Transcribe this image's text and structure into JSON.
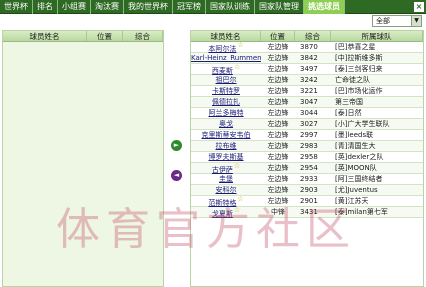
{
  "nav": {
    "items": [
      {
        "label": "世界杯",
        "active": false
      },
      {
        "label": "排名",
        "active": false
      },
      {
        "label": "小组赛",
        "active": false
      },
      {
        "label": "淘汰赛",
        "active": false
      },
      {
        "label": "我的世界杯",
        "active": false
      },
      {
        "label": "冠军榜",
        "active": false
      },
      {
        "label": "国家队训练",
        "active": false
      },
      {
        "label": "国家队管理",
        "active": false
      },
      {
        "label": "挑选球员",
        "active": true
      }
    ],
    "close": "×"
  },
  "filter": {
    "selected": "全部",
    "arrow": "▼"
  },
  "left_table": {
    "headers": {
      "name": "球员姓名",
      "position": "位置",
      "score": "综合"
    }
  },
  "right_table": {
    "headers": {
      "name": "球员姓名",
      "position": "位置",
      "score": "综合",
      "team": "所属球队"
    },
    "rows": [
      {
        "name": "本阿尔法",
        "star": true,
        "position": "左边锋",
        "score": "3870",
        "team": "[巴]恭喜之星"
      },
      {
        "name": "Karl-Heinz_Rummenigge",
        "star": false,
        "position": "左边锋",
        "score": "3842",
        "team": "[中]拉斯维多斯"
      },
      {
        "name": "西麦斯",
        "star": true,
        "position": "左边锋",
        "score": "3497",
        "team": "[泰]三剑客归来"
      },
      {
        "name": "祖巴尔",
        "star": false,
        "position": "左边锋",
        "score": "3242",
        "team": "亡命徒之队"
      },
      {
        "name": "卡斯特罗",
        "star": false,
        "position": "左边锋",
        "score": "3221",
        "team": "[巴]市场化运作"
      },
      {
        "name": "佩德拉扎",
        "star": false,
        "position": "左边锋",
        "score": "3047",
        "team": "第三帝国"
      },
      {
        "name": "阿兰多梅特",
        "star": false,
        "position": "左边锋",
        "score": "3044",
        "team": "[泰]日然"
      },
      {
        "name": "奥戈",
        "star": false,
        "position": "左边锋",
        "score": "3027",
        "team": "[小]广大学生联队"
      },
      {
        "name": "克里斯蒂安韦伯",
        "star": false,
        "position": "左边锋",
        "score": "2997",
        "team": "[墨]leeds联"
      },
      {
        "name": "拉布维",
        "star": false,
        "position": "左边锋",
        "score": "2983",
        "team": "[青]清国生大"
      },
      {
        "name": "博罗夫斯基",
        "star": false,
        "position": "左边锋",
        "score": "2958",
        "team": "[英]dexler之队"
      },
      {
        "name": "古伊萨",
        "star": true,
        "position": "左边锋",
        "score": "2954",
        "team": "[英]MOON队"
      },
      {
        "name": "圭堡",
        "star": false,
        "position": "左边锋",
        "score": "2933",
        "team": "[阿]三国终结者"
      },
      {
        "name": "安科尔",
        "star": false,
        "position": "左边锋",
        "score": "2903",
        "team": "[尤]Juventus"
      },
      {
        "name": "范斯特格",
        "star": true,
        "position": "左边锋",
        "score": "2901",
        "team": "[黄]江苏天"
      },
      {
        "name": "戈夏斯",
        "star": true,
        "position": "中锋",
        "score": "3431",
        "team": "[泰]milan第七军"
      }
    ]
  },
  "controls": {
    "add_arrow": "►",
    "remove_arrow": "◄"
  },
  "watermark": "体育官方社区"
}
